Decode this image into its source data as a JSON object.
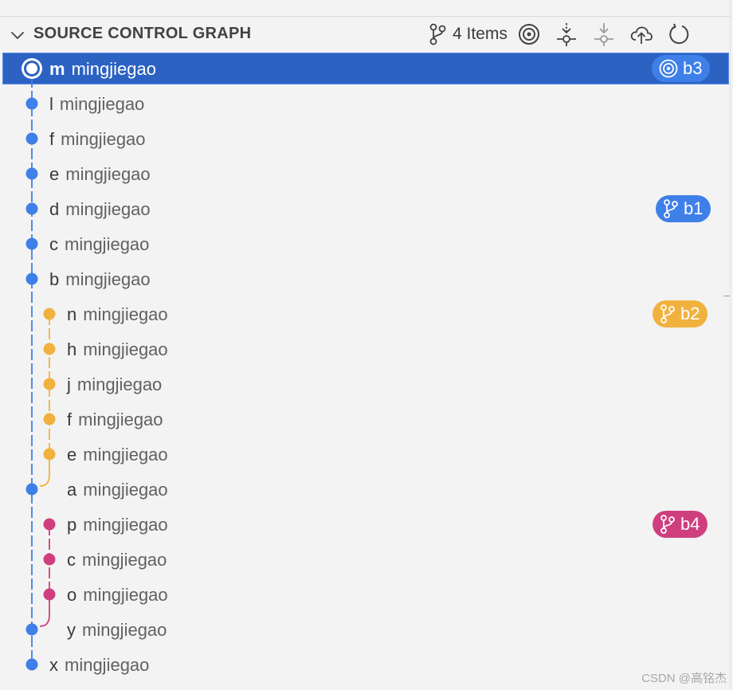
{
  "header": {
    "title": "SOURCE CONTROL GRAPH",
    "items_count": "4 Items",
    "actions": [
      "go-to-current-icon",
      "fetch-icon",
      "pull-icon",
      "push-icon",
      "refresh-icon"
    ]
  },
  "colors": {
    "main_branch": "#3f7fe8",
    "b2_branch": "#f1b13f",
    "b4_branch": "#cf3f7f",
    "selection": "#2c62c2",
    "b3_badge": "#3f7fe8",
    "b1_badge": "#3f7fe8"
  },
  "commits": [
    {
      "message": "m",
      "author": "mingjiegao",
      "lane": 0,
      "color": "main",
      "selected": true,
      "badge": {
        "label": "b3",
        "icon": "target-icon",
        "color": "#3f7fe8"
      }
    },
    {
      "message": "l",
      "author": "mingjiegao",
      "lane": 0,
      "color": "main"
    },
    {
      "message": "f",
      "author": "mingjiegao",
      "lane": 0,
      "color": "main"
    },
    {
      "message": "e",
      "author": "mingjiegao",
      "lane": 0,
      "color": "main"
    },
    {
      "message": "d",
      "author": "mingjiegao",
      "lane": 0,
      "color": "main",
      "badge": {
        "label": "b1",
        "icon": "branch-icon",
        "color": "#3f7fe8"
      }
    },
    {
      "message": "c",
      "author": "mingjiegao",
      "lane": 0,
      "color": "main"
    },
    {
      "message": "b",
      "author": "mingjiegao",
      "lane": 0,
      "color": "main"
    },
    {
      "message": "n",
      "author": "mingjiegao",
      "lane": 1,
      "color": "b2",
      "badge": {
        "label": "b2",
        "icon": "branch-icon",
        "color": "#f1b13f"
      }
    },
    {
      "message": "h",
      "author": "mingjiegao",
      "lane": 1,
      "color": "b2"
    },
    {
      "message": "j",
      "author": "mingjiegao",
      "lane": 1,
      "color": "b2"
    },
    {
      "message": "f",
      "author": "mingjiegao",
      "lane": 1,
      "color": "b2"
    },
    {
      "message": "e",
      "author": "mingjiegao",
      "lane": 1,
      "color": "b2"
    },
    {
      "message": "a",
      "author": "mingjiegao",
      "lane": 0,
      "color": "main",
      "offset_text": true
    },
    {
      "message": "p",
      "author": "mingjiegao",
      "lane": 1,
      "color": "b4",
      "badge": {
        "label": "b4",
        "icon": "branch-icon",
        "color": "#cf3f7f"
      }
    },
    {
      "message": "c",
      "author": "mingjiegao",
      "lane": 1,
      "color": "b4"
    },
    {
      "message": "o",
      "author": "mingjiegao",
      "lane": 1,
      "color": "b4"
    },
    {
      "message": "y",
      "author": "mingjiegao",
      "lane": 0,
      "color": "main",
      "offset_text": true
    },
    {
      "message": "x",
      "author": "mingjiegao",
      "lane": 0,
      "color": "main"
    }
  ],
  "watermark": "CSDN @高铭杰"
}
